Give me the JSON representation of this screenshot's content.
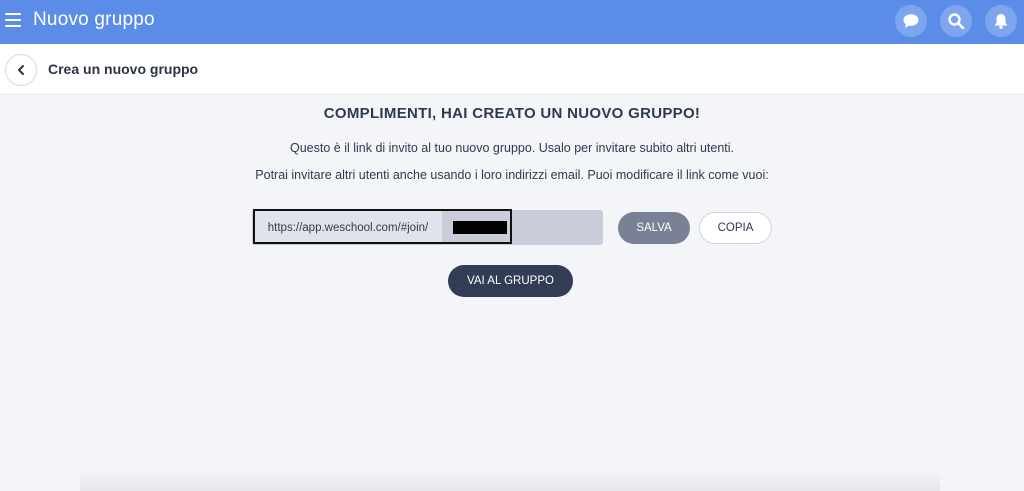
{
  "topbar": {
    "title": "Nuovo gruppo",
    "icons": [
      "menu-icon",
      "chat-icon",
      "search-icon",
      "bell-icon"
    ],
    "color": "#5b8de8"
  },
  "subheader": {
    "title": "Crea un nuovo gruppo",
    "back_icon": "chevron-left-icon"
  },
  "main": {
    "heading": "COMPLIMENTI, HAI CREATO UN NUOVO GRUPPO!",
    "description_1": "Questo è il link di invito al tuo nuovo gruppo. Usalo per invitare subito altri utenti.",
    "description_2": "Potrai invitare altri utenti anche usando i loro indirizzi email. Puoi modificare il link come vuoi:",
    "link_prefix": "https://app.weschool.com/#join/",
    "save_label": "SALVA",
    "copy_label": "COPIA",
    "go_label": "VAI AL GRUPPO"
  },
  "colors": {
    "primary_dark": "#323c54",
    "save_button": "#7a8195",
    "background": "#f4f5f9"
  }
}
